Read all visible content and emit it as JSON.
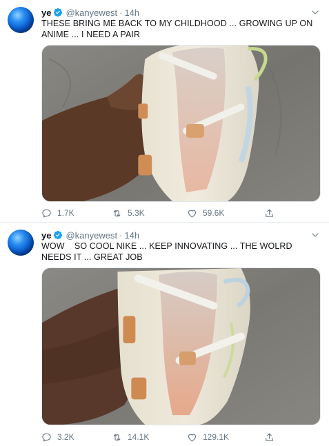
{
  "tweets": [
    {
      "name": "ye",
      "handle": "@kanyewest",
      "separator": "·",
      "time": "14h",
      "text": "THESE BRING ME BACK TO MY CHILDHOOD ... GROWING UP ON ANIME ... I NEED A PAIR",
      "replies": "1.7K",
      "retweets": "5.3K",
      "likes": "59.6K"
    },
    {
      "name": "ye",
      "handle": "@kanyewest",
      "separator": "·",
      "time": "14h",
      "text": "WOW    SO COOL NIKE ... KEEP INNOVATING ... THE WOLRD NEEDS IT ... GREAT JOB",
      "replies": "3.2K",
      "retweets": "14.1K",
      "likes": "129.1K"
    }
  ],
  "icons": {
    "verified": "verified-badge-icon",
    "more": "chevron-down-icon",
    "reply": "reply-icon",
    "retweet": "retweet-icon",
    "like": "heart-icon",
    "share": "share-icon"
  },
  "colors": {
    "verified": "#1da1f2",
    "icon": "#657786",
    "text": "#14171a",
    "divider": "#e6ecf0"
  }
}
